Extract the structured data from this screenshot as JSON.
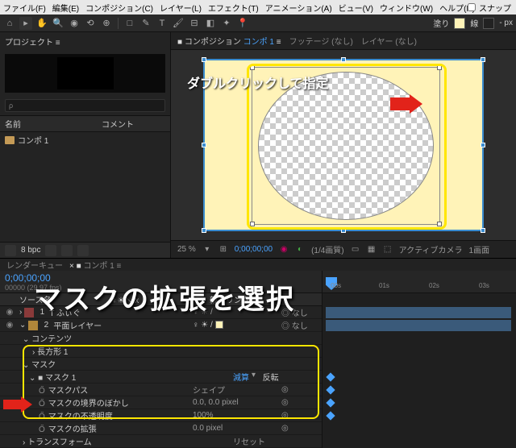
{
  "menu": [
    "ファイル(F)",
    "編集(E)",
    "コンポジション(C)",
    "レイヤー(L)",
    "エフェクト(T)",
    "アニメーション(A)",
    "ビュー(V)",
    "ウィンドウ(W)",
    "ヘルプ(H)"
  ],
  "topbar": {
    "snap": "スナップ",
    "fill": "塗り",
    "stroke": "線",
    "px": "- px"
  },
  "project": {
    "title": "プロジェクト ≡",
    "search_ph": "ρ",
    "col_name": "名前",
    "col_comment": "コメント",
    "item": "コンポ 1",
    "bpc": "8 bpc"
  },
  "viewer": {
    "tabs": {
      "comp": "コンポジション",
      "comp_name": "コンポ 1",
      "footage": "フッテージ (なし)",
      "layer": "レイヤー (なし)"
    },
    "status": {
      "zoom": "25 %",
      "tc": "0;00;00;00",
      "res": "(1/4画質)",
      "cam": "アクティブカメラ",
      "views": "1画面"
    }
  },
  "annotations": {
    "a1": "ダブルクリックして指定",
    "a2": "マスクの拡張を選択"
  },
  "timeline": {
    "tabs": {
      "rq": "レンダーキュー",
      "comp": "コンポ 1 ≡"
    },
    "tc": "0;00;00;00",
    "frames": "00000 (29.97 fps)",
    "cols": {
      "src": "ソース名",
      "sw": "♀☀＼fx",
      "parent": "親とリンク"
    },
    "layers": [
      {
        "n": "1",
        "name": "T  ふぃぐ",
        "color": "#8a3a3a",
        "sw": "♀ ☀ /",
        "link": "◎ なし"
      },
      {
        "n": "2",
        "name": "平面レイヤー",
        "color": "#b0863a",
        "sw": "♀ ☀ /",
        "link": "◎ なし"
      }
    ],
    "groups": {
      "contents": "コンテンツ",
      "rect": "› 長方形 1",
      "masks": "マスク",
      "mask1": "マスク 1",
      "transform": "トランスフォーム"
    },
    "mask_mode": "減算",
    "mask_inv": "反転",
    "props": [
      {
        "label": "マスクパス",
        "value": "シェイプ",
        "cls": "blue"
      },
      {
        "label": "マスクの境界のぼかし",
        "value": "0.0, 0.0 pixel",
        "cls": "blue"
      },
      {
        "label": "マスクの不透明度",
        "value": "100%",
        "cls": "blue"
      },
      {
        "label": "マスクの拡張",
        "value": "0.0 pixel",
        "cls": "blue"
      }
    ],
    "transform_val": "リセット",
    "ruler": [
      ";00s",
      "01s",
      "02s",
      "03s"
    ]
  }
}
